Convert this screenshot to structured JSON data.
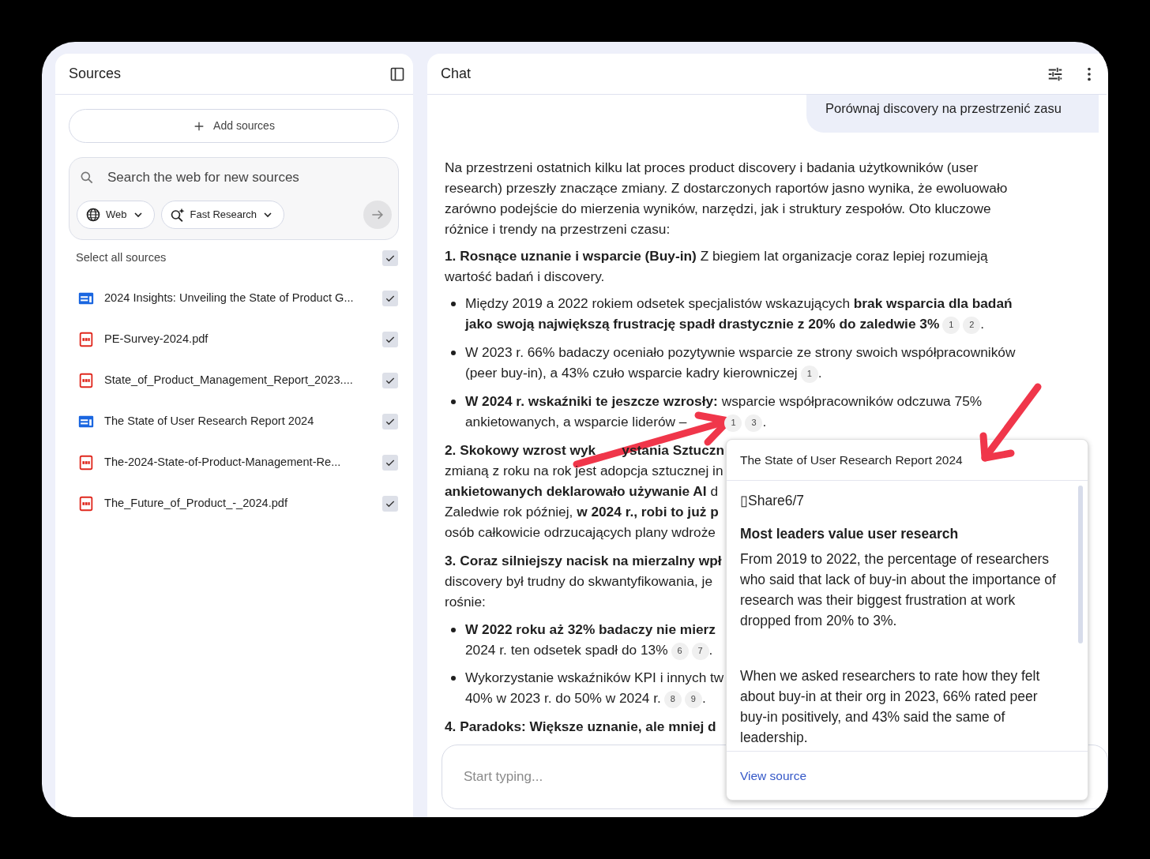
{
  "sources": {
    "title": "Sources",
    "add_button": "Add sources",
    "search": {
      "placeholder": "Search the web for new sources",
      "source_menu": "Web",
      "mode_menu": "Fast Research",
      "submit_disabled": true
    },
    "select_all": {
      "label": "Select all sources",
      "checked": true
    },
    "items": [
      {
        "kind": "web",
        "name": "2024 Insights: Unveiling the State of Product G...",
        "checked": true
      },
      {
        "kind": "pdf",
        "name": "PE-Survey-2024.pdf",
        "checked": true
      },
      {
        "kind": "pdf",
        "name": "State_of_Product_Management_Report_2023....",
        "checked": true
      },
      {
        "kind": "web",
        "name": "The State of User Research Report 2024",
        "checked": true
      },
      {
        "kind": "pdf",
        "name": "The-2024-State-of-Product-Management-Re...",
        "checked": true
      },
      {
        "kind": "pdf",
        "name": "The_Future_of_Product_-_2024.pdf",
        "checked": true
      }
    ]
  },
  "chat": {
    "title": "Chat",
    "user_message": "Porównaj discovery na przestrzenić zasu",
    "blocks": [
      {
        "kind": "paragraph",
        "text": "Na przestrzeni ostatnich kilku lat proces product discovery i badania użytkowników (user research) przeszły znaczące zmiany. Z dostarczonych raportów jasno wynika, że ewoluowało zarówno podejście do mierzenia wyników, narzędzi, jak i struktury zespołów. Oto kluczowe różnice i trendy na przestrzeni czasu:"
      },
      {
        "kind": "paragraph",
        "text": "**1. Rosnące uznanie i wsparcie (Buy-in)** Z biegiem lat organizacje coraz lepiej rozumieją wartość badań i discovery."
      },
      {
        "kind": "bullet",
        "text": "Między 2019 a 2022 rokiem odsetek specjalistów wskazujących **brak wsparcia dla badań jako swoją największą frustrację spadł drastycznie z 20% do zaledwie 3%**",
        "cites": [
          "1",
          "2"
        ],
        "end": "."
      },
      {
        "kind": "bullet",
        "text": "W 2023 r. 66% badaczy oceniało pozytywnie wsparcie ze strony swoich współpracowników (peer buy-in), a 43% czuło wsparcie kadry kierowniczej",
        "cites": [
          "1"
        ],
        "end": "."
      },
      {
        "kind": "bullet",
        "text": "**W 2024 r. wskaźniki te jeszcze wzrosły:** wsparcie współpracowników odczuwa 75% ankietowanych, a wsparcie liderów –",
        "cites": [
          "1",
          "3"
        ],
        "end": "."
      }
    ],
    "covered_lines": [
      {
        "kind": "heading",
        "parts": [
          "**2. Skokowy wzrost wyk**",
          "**ystania Sztuczn**"
        ]
      },
      {
        "kind": "line",
        "parts": [
          "zmianą z roku na rok jest adopcja sztucznej in"
        ]
      },
      {
        "kind": "line",
        "parts": [
          "**ankietowanych deklarowało używanie AI** d"
        ]
      },
      {
        "kind": "line",
        "parts": [
          "Zaledwie rok później, **w 2024 r., robi to już p**"
        ]
      },
      {
        "kind": "line",
        "parts": [
          "osób całkowicie odrzucających plany wdroże"
        ]
      },
      {
        "kind": "heading",
        "parts": [
          "**3. Coraz silniejszy nacisk na mierzalny wpł**"
        ]
      },
      {
        "kind": "line",
        "parts": [
          "discovery był trudny do skwantyfikowania, je"
        ]
      },
      {
        "kind": "line",
        "parts": [
          "rośnie:"
        ]
      },
      {
        "kind": "bullet",
        "parts": [
          "**W 2022 roku aż 32% badaczy nie mierz**"
        ]
      },
      {
        "kind": "cont",
        "parts": [
          "2024 r. ten odsetek spadł do 13%"
        ],
        "cites": [
          "6",
          "7"
        ],
        "end": "."
      },
      {
        "kind": "bullet",
        "parts": [
          "Wykorzystanie wskaźników KPI i innych tw"
        ]
      },
      {
        "kind": "cont",
        "parts": [
          "40% w 2023 r. do 50% w 2024 r."
        ],
        "cites": [
          "8",
          "9"
        ],
        "end": "."
      },
      {
        "kind": "heading",
        "parts": [
          "**4. Paradoks: Większe uznanie, ale mniej d**"
        ]
      }
    ],
    "composer": {
      "placeholder": "Start typing..."
    },
    "citation_popup": {
      "title": "The State of User Research Report 2024",
      "share_line": "▯Share6/7",
      "heading": "Most leaders value user research",
      "paragraphs": [
        "From 2019 to 2022, the percentage of researchers who said that lack of buy-in about the importance of research was their biggest frustration at work dropped from 20% to 3%.",
        "When we asked researchers to rate how they felt about buy-in at their org in 2023, 66% rated peer buy-in positively, and 43% said the same of leadership."
      ],
      "link": "View source"
    }
  }
}
